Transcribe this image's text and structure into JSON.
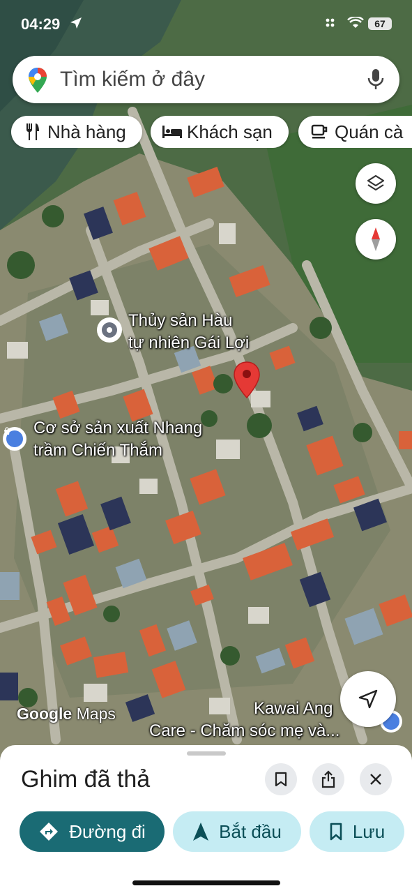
{
  "status_bar": {
    "time": "04:29",
    "battery": "67"
  },
  "search": {
    "placeholder": "Tìm kiếm ở đây"
  },
  "chips": [
    {
      "label": "Nhà hàng",
      "icon": "fork-knife-icon"
    },
    {
      "label": "Khách sạn",
      "icon": "bed-icon"
    },
    {
      "label": "Quán cà",
      "icon": "coffee-cup-icon"
    }
  ],
  "map": {
    "places": [
      {
        "line1": "Thủy sản Hàu",
        "line2": "tự nhiên Gái Lợi",
        "icon": "place-dot-icon"
      },
      {
        "line1": "Cơ sở sản xuất Nhang",
        "line2": "trầm Chiến Thắm",
        "icon": "shopping-bag-icon"
      },
      {
        "line1": "Kawai Ang",
        "line2": "Care - Chăm sóc mẹ và...",
        "icon": "shopping-bag-icon"
      }
    ],
    "watermark_google": "Google",
    "watermark_maps": "Maps",
    "colors": {
      "pin_red": "#e53935",
      "accent_teal": "#1a6b74",
      "tonal_cyan": "#c5ecf3"
    }
  },
  "sheet": {
    "title": "Ghim đã thả",
    "actions": {
      "directions": "Đường đi",
      "start": "Bắt đầu",
      "save": "Lưu"
    }
  }
}
